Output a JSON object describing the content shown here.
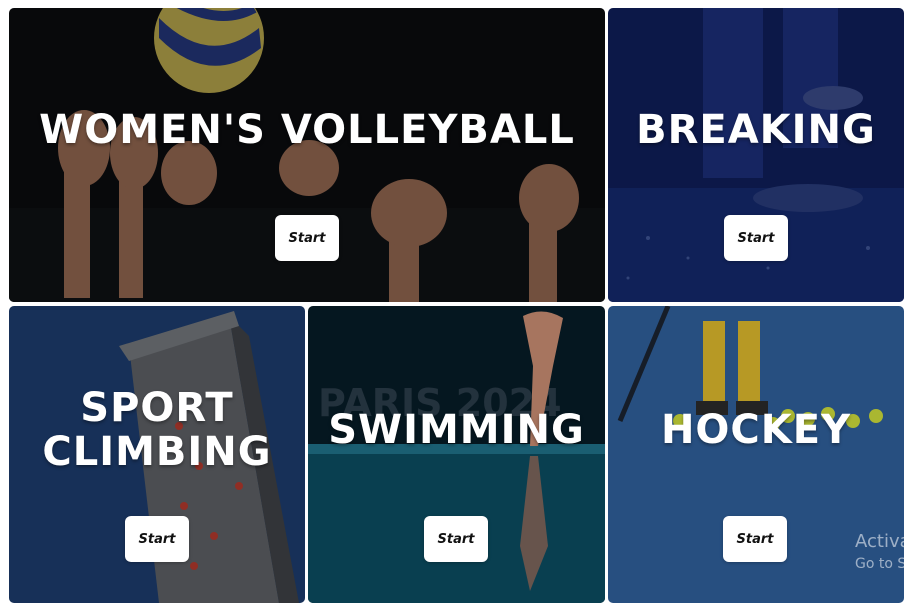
{
  "cards": [
    {
      "title_lines": [
        "WOMEN'S VOLLEYBALL"
      ],
      "button": "Start"
    },
    {
      "title_lines": [
        "BREAKING"
      ],
      "button": "Start"
    },
    {
      "title_lines": [
        "SPORT",
        "CLIMBING"
      ],
      "button": "Start"
    },
    {
      "title_lines": [
        "SWIMMING"
      ],
      "button": "Start"
    },
    {
      "title_lines": [
        "HOCKEY"
      ],
      "button": "Start"
    }
  ],
  "swimming_bg_text": "PARIS 2024",
  "watermark": {
    "line1": "Activat",
    "line2": "Go to Se"
  },
  "colors": {
    "volleyball_bg": "#0d0f12",
    "breaking_bg": "#0f1f5a",
    "climbing_bg": "#1d3d6e",
    "swimming_bg": "#071c26",
    "hockey_bg": "#2e5d97"
  }
}
